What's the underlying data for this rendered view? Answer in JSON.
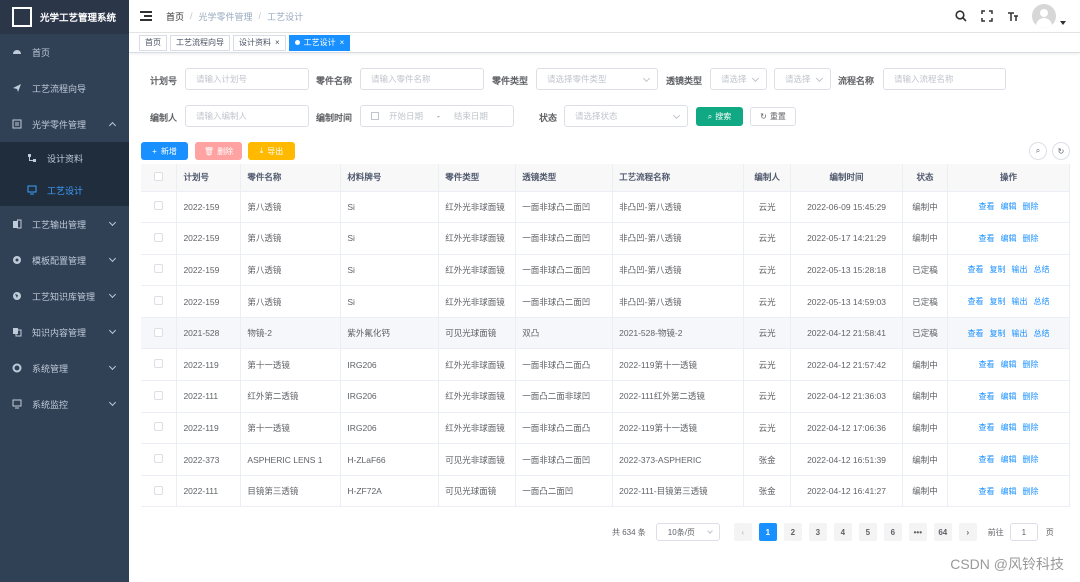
{
  "app": {
    "title": "光学工艺管理系统"
  },
  "sidebar": {
    "items": [
      {
        "label": "首页",
        "icon": "dashboard-icon"
      },
      {
        "label": "工艺流程向导",
        "icon": "send-icon"
      },
      {
        "label": "光学零件管理",
        "icon": "list-icon",
        "expanded": true
      },
      {
        "label": "工艺输出管理",
        "icon": "documents-icon"
      },
      {
        "label": "模板配置管理",
        "icon": "settings-icon"
      },
      {
        "label": "工艺知识库管理",
        "icon": "globe-icon"
      },
      {
        "label": "知识内容管理",
        "icon": "copy-icon"
      },
      {
        "label": "系统管理",
        "icon": "gear-icon"
      },
      {
        "label": "系统监控",
        "icon": "monitor-icon"
      }
    ],
    "submenu": [
      {
        "label": "设计资料",
        "icon": "sub-tree-icon"
      },
      {
        "label": "工艺设计",
        "icon": "monitor-icon",
        "active": true
      }
    ]
  },
  "breadcrumb": [
    "首页",
    "光学零件管理",
    "工艺设计"
  ],
  "tags": [
    {
      "label": "首页"
    },
    {
      "label": "工艺流程向导"
    },
    {
      "label": "设计资料",
      "closable": true
    },
    {
      "label": "工艺设计",
      "closable": true,
      "active": true
    }
  ],
  "filters": {
    "plan_no": {
      "label": "计划号",
      "placeholder": "请输入计划号"
    },
    "part_name": {
      "label": "零件名称",
      "placeholder": "请输入零件名称"
    },
    "part_type": {
      "label": "零件类型",
      "placeholder": "请选择零件类型"
    },
    "lens_type": {
      "label": "透镜类型",
      "placeholder1": "请选择",
      "placeholder2": "请选择"
    },
    "flow_name": {
      "label": "流程名称",
      "placeholder": "请输入流程名称"
    },
    "editor": {
      "label": "编制人",
      "placeholder": "请输入编制人"
    },
    "edit_time": {
      "label": "编制时间",
      "start": "开始日期",
      "sep": "-",
      "end": "结束日期"
    },
    "status": {
      "label": "状态",
      "placeholder": "请选择状态"
    },
    "search_btn": "搜索",
    "reset_btn": "重置"
  },
  "toolbar": {
    "add": "新增",
    "delete": "删除",
    "export": "导出"
  },
  "table": {
    "headers": [
      "计划号",
      "零件名称",
      "材料牌号",
      "零件类型",
      "透镜类型",
      "工艺流程名称",
      "编制人",
      "编制时间",
      "状态",
      "操作"
    ],
    "rows": [
      {
        "plan": "2022-159",
        "part": "第八透镜",
        "material": "Si",
        "type": "红外光非球面镜",
        "lens": "一面非球凸二面凹",
        "flow": "非凸凹-第八透镜",
        "editor": "云光",
        "time": "2022-06-09 15:45:29",
        "status": "编制中",
        "ops": [
          "查看",
          "编辑",
          "删除"
        ]
      },
      {
        "plan": "2022-159",
        "part": "第八透镜",
        "material": "Si",
        "type": "红外光非球面镜",
        "lens": "一面非球凸二面凹",
        "flow": "非凸凹-第八透镜",
        "editor": "云光",
        "time": "2022-05-17 14:21:29",
        "status": "编制中",
        "ops": [
          "查看",
          "编辑",
          "删除"
        ]
      },
      {
        "plan": "2022-159",
        "part": "第八透镜",
        "material": "Si",
        "type": "红外光非球面镜",
        "lens": "一面非球凸二面凹",
        "flow": "非凸凹-第八透镜",
        "editor": "云光",
        "time": "2022-05-13 15:28:18",
        "status": "已定稿",
        "ops": [
          "查看",
          "复制",
          "输出",
          "总结"
        ]
      },
      {
        "plan": "2022-159",
        "part": "第八透镜",
        "material": "Si",
        "type": "红外光非球面镜",
        "lens": "一面非球凸二面凹",
        "flow": "非凸凹-第八透镜",
        "editor": "云光",
        "time": "2022-05-13 14:59:03",
        "status": "已定稿",
        "ops": [
          "查看",
          "复制",
          "输出",
          "总结"
        ]
      },
      {
        "plan": "2021-528",
        "part": "物镜-2",
        "material": "紫外氟化钙",
        "type": "可见光球面镜",
        "lens": "双凸",
        "flow": "2021-528-物镜-2",
        "editor": "云光",
        "time": "2022-04-12 21:58:41",
        "status": "已定稿",
        "ops": [
          "查看",
          "复制",
          "输出",
          "总结"
        ],
        "highlight": true
      },
      {
        "plan": "2022-119",
        "part": "第十一透镜",
        "material": "IRG206",
        "type": "红外光非球面镜",
        "lens": "一面非球凸二面凸",
        "flow": "2022-119第十一透镜",
        "editor": "云光",
        "time": "2022-04-12 21:57:42",
        "status": "编制中",
        "ops": [
          "查看",
          "编辑",
          "删除"
        ]
      },
      {
        "plan": "2022-111",
        "part": "红外第二透镜",
        "material": "IRG206",
        "type": "红外光非球面镜",
        "lens": "一面凸二面非球凹",
        "flow": "2022-111红外第二透镜",
        "editor": "云光",
        "time": "2022-04-12 21:36:03",
        "status": "编制中",
        "ops": [
          "查看",
          "编辑",
          "删除"
        ]
      },
      {
        "plan": "2022-119",
        "part": "第十一透镜",
        "material": "IRG206",
        "type": "红外光非球面镜",
        "lens": "一面非球凸二面凸",
        "flow": "2022-119第十一透镜",
        "editor": "云光",
        "time": "2022-04-12 17:06:36",
        "status": "编制中",
        "ops": [
          "查看",
          "编辑",
          "删除"
        ]
      },
      {
        "plan": "2022-373",
        "part": "ASPHERIC LENS 1",
        "material": "H-ZLaF66",
        "type": "可见光非球面镜",
        "lens": "一面非球凸二面凹",
        "flow": "2022-373-ASPHERIC",
        "editor": "张金",
        "time": "2022-04-12 16:51:39",
        "status": "编制中",
        "ops": [
          "查看",
          "编辑",
          "删除"
        ]
      },
      {
        "plan": "2022-111",
        "part": "目镜第三透镜",
        "material": "H-ZF72A",
        "type": "可见光球面镜",
        "lens": "一面凸二面凹",
        "flow": "2022-111-目镜第三透镜",
        "editor": "张金",
        "time": "2022-04-12 16:41:27",
        "status": "编制中",
        "ops": [
          "查看",
          "编辑",
          "删除"
        ]
      }
    ]
  },
  "pagination": {
    "total": "共 634 条",
    "page_size": "10条/页",
    "pages": [
      "1",
      "2",
      "3",
      "4",
      "5",
      "6",
      "•••",
      "64"
    ],
    "current": "1",
    "goto_label": "前往",
    "goto_value": "1",
    "goto_suffix": "页"
  },
  "watermark": "CSDN @风铃科技"
}
